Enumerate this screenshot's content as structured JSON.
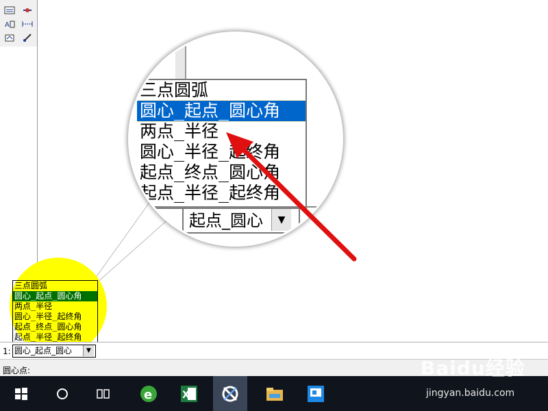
{
  "dropdown": {
    "options": [
      "三点圆弧",
      "圆心_起点_圆心角",
      "两点_半径",
      "圆心_半径_起终角",
      "起点_终点_圆心角",
      "起点_半径_起终角"
    ],
    "selected": "圆心_起点_圆心角"
  },
  "magnified": {
    "rows": [
      "三点圆弧",
      "圆心_起点_圆心角",
      "两点_半径",
      "圆心_半径_起终角",
      "起点_终点_圆心角",
      "起点_半径_起终角"
    ],
    "combo_value": "起点_圆心"
  },
  "command": {
    "prefix": "1:",
    "combo_value": "圆心_起点_圆心"
  },
  "status": {
    "prompt": "圆心点:"
  },
  "watermark": {
    "logo": "Baidu经验",
    "url": "jingyan.baidu.com"
  },
  "colors": {
    "highlight": "#ffff00",
    "selected_small": "#007000",
    "selected_magnified": "#0066cc",
    "arrow": "#e01010",
    "taskbar": "#10141c"
  },
  "icons": {
    "toolbar": [
      "arc-tool-icon",
      "dimension-icon",
      "text-align-icon",
      "horizontal-dim-icon",
      "rotate-icon",
      "brush-icon"
    ],
    "taskbar": [
      "windows-start-icon",
      "cortana-icon",
      "task-view-icon",
      "browser-icon",
      "excel-icon",
      "cad-app-icon",
      "file-explorer-icon",
      "app-icon"
    ]
  }
}
